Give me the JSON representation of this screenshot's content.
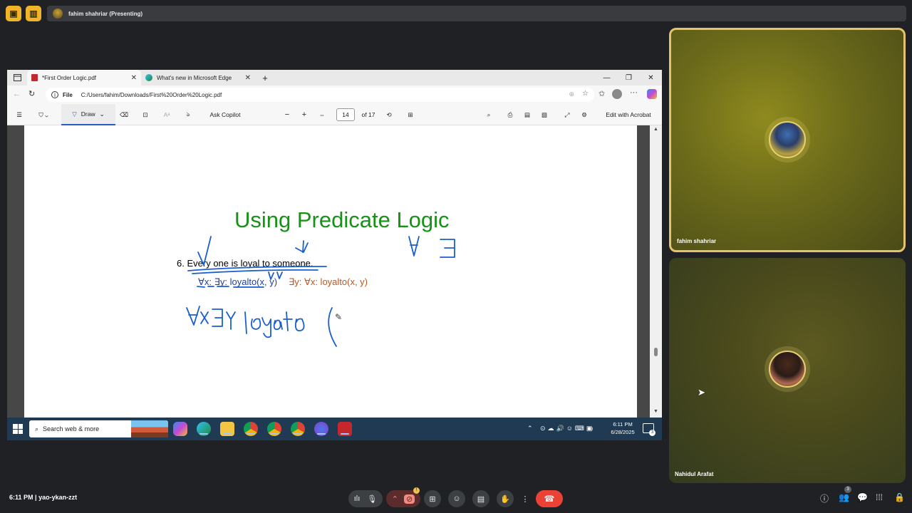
{
  "meet": {
    "presenter_banner": "fahim shahriar (Presenting)",
    "meeting_time": "6:11 PM",
    "meeting_code": "yao-ykan-zzt",
    "people_count": "3"
  },
  "browser": {
    "tabs": [
      {
        "label": "*First Order Logic.pdf",
        "active": true
      },
      {
        "label": "What's new in Microsoft Edge",
        "active": false
      }
    ],
    "url_prefix": "File",
    "url": "C:/Users/fahim/Downloads/First%20Order%20Logic.pdf"
  },
  "pdf_toolbar": {
    "draw_label": "Draw",
    "copilot_label": "Ask Copilot",
    "current_page": "14",
    "page_total": "of 17",
    "acrobat_label": "Edit with Acrobat"
  },
  "slide": {
    "title": "Using Predicate Logic",
    "statement_prefix": "6. ",
    "statement_a": "Every",
    "statement_b": " one is loyal to ",
    "statement_c": "someone",
    "statement_d": ".",
    "formula_1a": "∀x",
    "formula_1b": ": ",
    "formula_1c": "∃y",
    "formula_1d": ": ",
    "formula_1e": "loyalto(x, y)",
    "formula_2": "∃y: ∀x: loyalto(x, y)"
  },
  "taskbar": {
    "search_placeholder": "Search web & more",
    "time": "6:11 PM",
    "date": "6/28/2025",
    "notification_count": "3"
  },
  "participants": [
    {
      "name": "fahim shahriar"
    },
    {
      "name": "Nahidul Arafat"
    }
  ],
  "colors": {
    "slide_title": "#169216",
    "formula_blue": "#1f3fa8",
    "formula_orange": "#c0561a",
    "ink_blue": "#1a5fd0",
    "leave_red": "#ea4335",
    "active_tile_border": "#e6c26c"
  }
}
